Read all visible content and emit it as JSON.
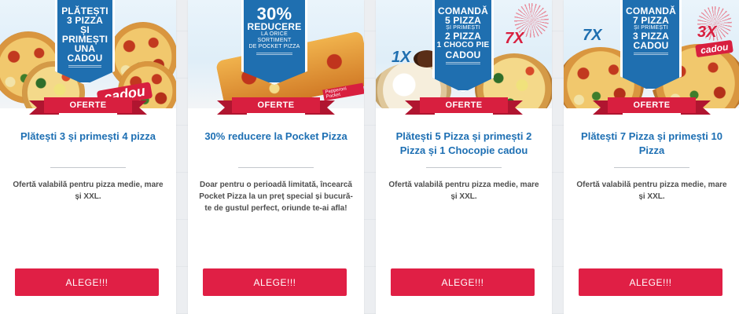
{
  "brand": {
    "accent": "#d81f3f",
    "blue": "#1d6fb3",
    "button": "#e01f45"
  },
  "offers": [
    {
      "shield_lines": [
        "PLĂTEȘTI",
        "3 PIZZA",
        "ȘI PRIMEȘTI",
        "UNA CADOU"
      ],
      "badge": "cadou",
      "ribbon": "OFERTE",
      "title": "Plătești 3 și primești 4 pizza",
      "description": "Ofertă valabilă pentru pizza medie, mare și XXL.",
      "button": "ALEGE!!!"
    },
    {
      "shield_lines": [
        "30%",
        "REDUCERE",
        "LA ORICE SORTIMENT",
        "DE POCKET PIZZA"
      ],
      "tag": "Pepperoni Pocket",
      "ribbon": "OFERTE",
      "title": "30% reducere la Pocket Pizza",
      "description": "Doar pentru o perioadă limitată, încearcă Pocket Pizza la un preț special și bucură-te de gustul perfect, oriunde te-ai afla!",
      "button": "ALEGE!!!"
    },
    {
      "shield_lines": [
        "COMANDĂ",
        "5 PIZZA",
        "și primești",
        "2 PIZZA",
        "1 CHOCO PIE",
        "CADOU"
      ],
      "mult_left": "1X",
      "mult_right": "7X",
      "ribbon": "OFERTE",
      "title": "Plătești 5 Pizza și primești 2 Pizza și 1 Chocopie cadou",
      "description": "Ofertă valabilă pentru pizza medie, mare și XXL.",
      "button": "ALEGE!!!"
    },
    {
      "shield_lines": [
        "COMANDĂ",
        "7 PIZZA",
        "și primești",
        "3 PIZZA",
        "CADOU"
      ],
      "mult_left": "7X",
      "mult_right": "3X",
      "badge": "cadou",
      "ribbon": "OFERTE",
      "title": "Plătești 7 Pizza și primești 10 Pizza",
      "description": "Ofertă valabilă pentru pizza medie, mare și XXL.",
      "button": "ALEGE!!!"
    }
  ]
}
